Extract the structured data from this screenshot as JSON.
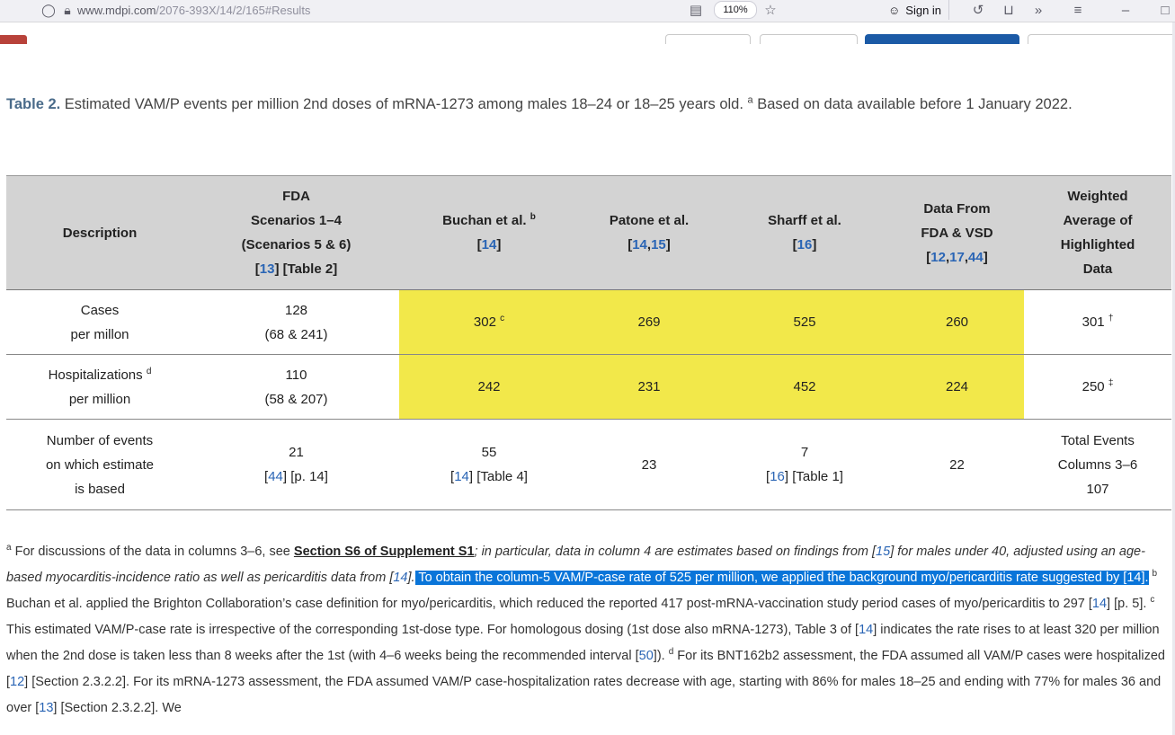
{
  "browser": {
    "url_host": "www.mdpi.com",
    "url_path": "/2076-393X/14/2/165#Results",
    "zoom": "110%",
    "sign_in": "Sign in"
  },
  "caption": {
    "label": "Table 2.",
    "text_1": " Estimated VAM/P events per million 2nd doses of mRNA-1273 among males 18–24 or 18–25 years old. ",
    "sup": "a",
    "text_2": " Based on data available before 1 January 2022."
  },
  "table": {
    "headers": {
      "description": "Description",
      "fda_1": "FDA",
      "fda_2": "Scenarios 1–4",
      "fda_3": "(Scenarios 5 & 6)",
      "fda_ref": "13",
      "fda_ref_after": " [Table 2]",
      "buchan": "Buchan et al.",
      "buchan_sup": "b",
      "buchan_ref": "14",
      "patone": "Patone et al.",
      "patone_ref_a": "14",
      "patone_ref_b": "15",
      "sharff": "Sharff et al.",
      "sharff_ref": "16",
      "vsd_1": "Data From",
      "vsd_2": "FDA & VSD",
      "vsd_ref_a": "12",
      "vsd_ref_b": "17",
      "vsd_ref_c": "44",
      "wa_1": "Weighted",
      "wa_2": "Average of",
      "wa_3": "Highlighted",
      "wa_4": "Data"
    },
    "rows": {
      "cases": {
        "desc_1": "Cases",
        "desc_2": "per millon",
        "fda_1": "128",
        "fda_2": "(68 & 241)",
        "buchan": "302",
        "buchan_sup": "c",
        "patone": "269",
        "sharff": "525",
        "vsd": "260",
        "wa": "301",
        "wa_sup": "†"
      },
      "hosp": {
        "desc_1": "Hospitalizations",
        "desc_sup": "d",
        "desc_2": "per million",
        "fda_1": "110",
        "fda_2": "(58 & 207)",
        "buchan": "242",
        "patone": "231",
        "sharff": "452",
        "vsd": "224",
        "wa": "250",
        "wa_sup": "‡"
      },
      "events": {
        "desc_1": "Number of events",
        "desc_2": "on which estimate",
        "desc_3": "is based",
        "fda_1": "21",
        "fda_ref": "44",
        "fda_ref_after": " [p. 14]",
        "buchan_1": "55",
        "buchan_ref": "14",
        "buchan_ref_after": " [Table 4]",
        "patone": "23",
        "sharff_1": "7",
        "sharff_ref": "16",
        "sharff_ref_after": " [Table 1]",
        "vsd": "22",
        "wa_1": "Total Events",
        "wa_2": "Columns 3–6",
        "wa_3": "107"
      }
    }
  },
  "footnotes": {
    "a_sup": "a",
    "a_1": " For discussions of the data in columns 3–6, see ",
    "a_link": "Section S6 of Supplement S1",
    "a_2": "; in particular, data in column 4 are estimates based on findings from [",
    "a_ref1": "15",
    "a_3": "] for males under 40, adjusted using an age-based myocarditis-incidence ratio as well as pericarditis data from [",
    "a_ref2": "14",
    "a_4": "].",
    "selected": " To obtain the column-5 VAM/P-case rate of 525 per million, we applied the background myo/pericarditis rate suggested by [14].",
    "b_sup": "b",
    "b_text": " Buchan et al. applied the Brighton Collaboration’s case definition for myo/pericarditis, which reduced the reported 417 post-mRNA-vaccination study period cases of myo/pericarditis to 297 [",
    "b_ref": "14",
    "b_after": "] [p. 5]. ",
    "c_sup": "c",
    "c_text": " This estimated VAM/P-case rate is irrespective of the corresponding 1st-dose type. For homologous dosing (1st dose also mRNA-1273), Table 3 of [",
    "c_ref1": "14",
    "c_text2": "] indicates the rate rises to at least 320 per million when the 2nd dose is taken less than 8 weeks after the 1st (with 4–6 weeks being the recommended interval [",
    "c_ref2": "50",
    "c_after": "]). ",
    "d_sup": "d",
    "d_text": " For its BNT162b2 assessment, the FDA assumed all VAM/P cases were hospitalized [",
    "d_ref1": "12",
    "d_text2": "] [Section 2.3.2.2]. For its mRNA-1273 assessment, the FDA assumed VAM/P case-hospitalization rates decrease with age, starting with 86% for males 18–25 and ending with 77% for males 36 and over [",
    "d_ref2": "13",
    "d_after": "] [Section 2.3.2.2]. We"
  }
}
